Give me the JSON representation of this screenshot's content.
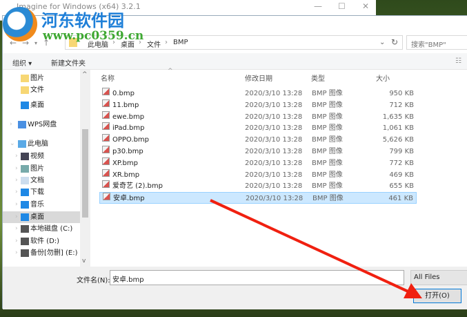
{
  "background_window": {
    "title": "Imagine for Windows (x64) 3.2.1"
  },
  "watermark": {
    "name": "河东软件园",
    "url": "www.pc0359.cn"
  },
  "dialog": {
    "title": "打开"
  },
  "address": {
    "crumbs": [
      "此电脑",
      "桌面",
      "文件",
      "BMP"
    ]
  },
  "search": {
    "placeholder": "搜索\"BMP\""
  },
  "toolbar": {
    "organize": "组织 ▾",
    "new_folder": "新建文件夹"
  },
  "nav": [
    {
      "label": "图片",
      "icon": "folder-icon"
    },
    {
      "label": "文件",
      "icon": "folder-icon"
    },
    {
      "label": "桌面",
      "icon": "desktop-icon"
    },
    {
      "label": "WPS网盘",
      "icon": "cloud-icon"
    },
    {
      "label": "此电脑",
      "icon": "computer-icon"
    },
    {
      "label": "视频",
      "icon": "video-icon"
    },
    {
      "label": "图片",
      "icon": "picture-icon"
    },
    {
      "label": "文档",
      "icon": "document-icon"
    },
    {
      "label": "下载",
      "icon": "download-icon"
    },
    {
      "label": "音乐",
      "icon": "music-icon"
    },
    {
      "label": "桌面",
      "icon": "desktop-icon"
    },
    {
      "label": "本地磁盘 (C:)",
      "icon": "drive-icon"
    },
    {
      "label": "软件 (D:)",
      "icon": "drive-icon"
    },
    {
      "label": "备份[勿删] (E:)",
      "icon": "drive-icon"
    }
  ],
  "columns": {
    "name": "名称",
    "date": "修改日期",
    "type": "类型",
    "size": "大小"
  },
  "files": [
    {
      "name": "0.bmp",
      "date": "2020/3/10 13:28",
      "type": "BMP 图像",
      "size": "950 KB"
    },
    {
      "name": "11.bmp",
      "date": "2020/3/10 13:28",
      "type": "BMP 图像",
      "size": "712 KB"
    },
    {
      "name": "ewe.bmp",
      "date": "2020/3/10 13:28",
      "type": "BMP 图像",
      "size": "1,635 KB"
    },
    {
      "name": "iPad.bmp",
      "date": "2020/3/10 13:28",
      "type": "BMP 图像",
      "size": "1,061 KB"
    },
    {
      "name": "OPPO.bmp",
      "date": "2020/3/10 13:28",
      "type": "BMP 图像",
      "size": "5,626 KB"
    },
    {
      "name": "p30.bmp",
      "date": "2020/3/10 13:28",
      "type": "BMP 图像",
      "size": "799 KB"
    },
    {
      "name": "XP.bmp",
      "date": "2020/3/10 13:28",
      "type": "BMP 图像",
      "size": "772 KB"
    },
    {
      "name": "XR.bmp",
      "date": "2020/3/10 13:28",
      "type": "BMP 图像",
      "size": "469 KB"
    },
    {
      "name": "爱奇艺 (2).bmp",
      "date": "2020/3/10 13:28",
      "type": "BMP 图像",
      "size": "655 KB"
    },
    {
      "name": "安卓.bmp",
      "date": "2020/3/10 13:28",
      "type": "BMP 图像",
      "size": "461 KB"
    }
  ],
  "selected_index": 9,
  "bottom": {
    "filename_label": "文件名(N):",
    "filename_value": "安卓.bmp",
    "filetype": "All Files",
    "open_button": "打开(O)"
  }
}
